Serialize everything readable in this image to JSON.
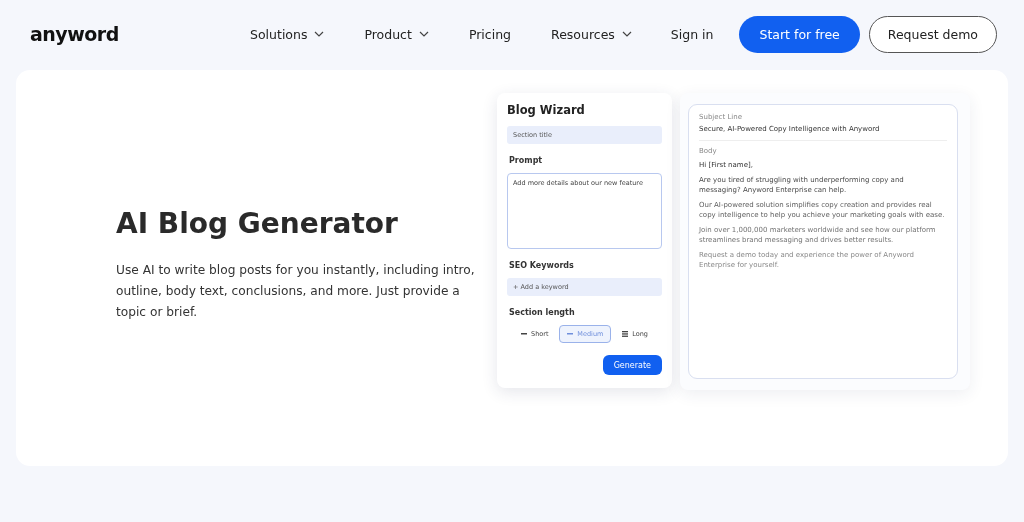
{
  "header": {
    "logo": "anyword",
    "nav": [
      {
        "label": "Solutions",
        "dropdown": true
      },
      {
        "label": "Product",
        "dropdown": true
      },
      {
        "label": "Pricing",
        "dropdown": false
      },
      {
        "label": "Resources",
        "dropdown": true
      }
    ],
    "sign_in": "Sign in",
    "primary_button": "Start for free",
    "secondary_button": "Request demo"
  },
  "hero": {
    "title": "AI Blog Generator",
    "description": "Use AI to write blog posts for you instantly, including intro, outline, body text, conclusions, and more. Just provide a topic or brief."
  },
  "wizard": {
    "title": "Blog Wizard",
    "section_title_placeholder": "Section title",
    "prompt_label": "Prompt",
    "prompt_value": "Add more details about our new feature",
    "keywords_label": "SEO Keywords",
    "keyword_placeholder": "+ Add a keyword",
    "length_label": "Section length",
    "lengths": [
      {
        "label": "Short",
        "kind": "short",
        "selected": false
      },
      {
        "label": "Medium",
        "kind": "medium",
        "selected": true
      },
      {
        "label": "Long",
        "kind": "long",
        "selected": false
      }
    ],
    "generate": "Generate"
  },
  "email": {
    "subject_label": "Subject Line",
    "subject": "Secure, AI-Powered Copy Intelligence with Anyword",
    "body_label": "Body",
    "paragraphs": [
      "Hi [First name],",
      "Are you tired of struggling with underperforming copy and messaging? Anyword Enterprise can help.",
      "Our AI-powered solution simplifies copy creation and provides real copy  intelligence to help you achieve your marketing goals with ease.",
      "Join over 1,000,000 marketers worldwide and see how our platform streamlines brand messaging and drives better results.",
      "Request a demo today and experience the power of Anyword Enterprise for yourself."
    ]
  }
}
